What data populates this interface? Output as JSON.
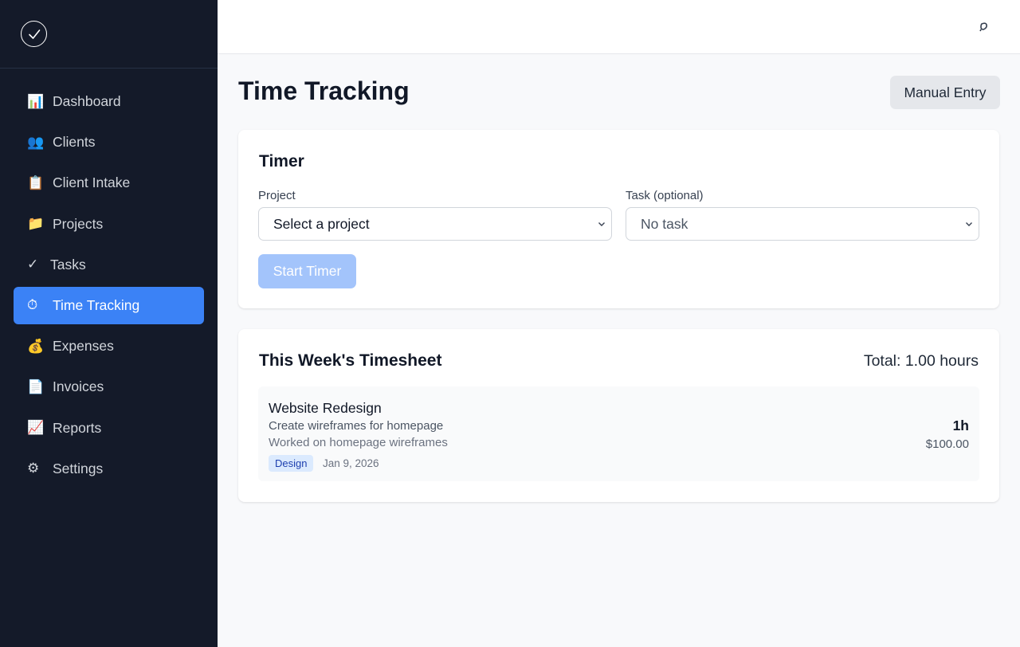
{
  "sidebar": {
    "items": [
      {
        "icon": "📊",
        "label": "Dashboard"
      },
      {
        "icon": "👥",
        "label": "Clients"
      },
      {
        "icon": "📋",
        "label": "Client Intake"
      },
      {
        "icon": "📁",
        "label": "Projects"
      },
      {
        "icon": "✓",
        "label": "Tasks"
      },
      {
        "icon": "⏱",
        "label": "Time Tracking"
      },
      {
        "icon": "💰",
        "label": "Expenses"
      },
      {
        "icon": "📄",
        "label": "Invoices"
      },
      {
        "icon": "📈",
        "label": "Reports"
      },
      {
        "icon": "⚙",
        "label": "Settings"
      }
    ],
    "active_item": "Time Tracking"
  },
  "header": {
    "title": "Time Tracking",
    "manual_entry_label": "Manual Entry"
  },
  "timer": {
    "title": "Timer",
    "project_label": "Project",
    "project_value": "Select a project",
    "task_label": "Task (optional)",
    "task_value": "No task",
    "start_label": "Start Timer"
  },
  "timesheet": {
    "title": "This Week's Timesheet",
    "total": "Total: 1.00 hours",
    "entries": [
      {
        "project": "Website Redesign",
        "task": "Create wireframes for homepage",
        "description": "Worked on homepage wireframes",
        "tag": "Design",
        "date": "Jan 9, 2026",
        "hours": "1h",
        "amount": "$100.00"
      }
    ]
  },
  "colors": {
    "sidebar_bg": "#141a29",
    "accent": "#3b82f6",
    "start_disabled": "#a3c4fb",
    "tag_bg": "#dbeafe"
  }
}
